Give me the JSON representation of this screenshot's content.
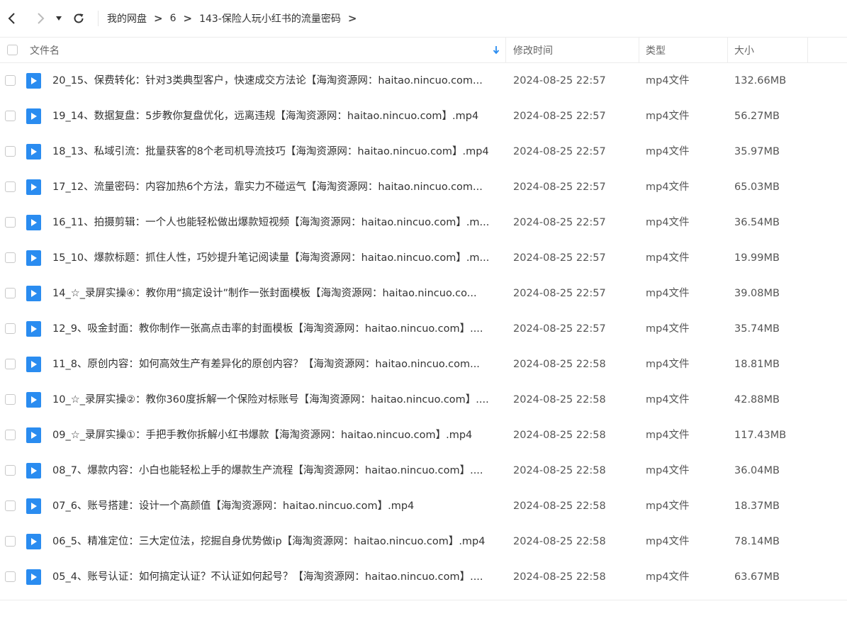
{
  "toolbar": {
    "breadcrumb": [
      "我的网盘",
      "6",
      "143-保险人玩小红书的流量密码"
    ]
  },
  "columns": {
    "name": "文件名",
    "modified": "修改时间",
    "type": "类型",
    "size": "大小"
  },
  "colors": {
    "file_icon": "#2a8cf0",
    "sort_arrow": "#2a8cf0"
  },
  "files": [
    {
      "name": "20_15、保费转化：针对3类典型客户，快速成交方法论【海淘资源网：haitao.nincuo.com...",
      "modified": "2024-08-25 22:57",
      "type": "mp4文件",
      "size": "132.66MB"
    },
    {
      "name": "19_14、数据复盘：5步教你复盘优化，远离违规【海淘资源网：haitao.nincuo.com】.mp4",
      "modified": "2024-08-25 22:57",
      "type": "mp4文件",
      "size": "56.27MB"
    },
    {
      "name": "18_13、私域引流：批量获客的8个老司机导流技巧【海淘资源网：haitao.nincuo.com】.mp4",
      "modified": "2024-08-25 22:57",
      "type": "mp4文件",
      "size": "35.97MB"
    },
    {
      "name": "17_12、流量密码：内容加热6个方法，靠实力不碰运气【海淘资源网：haitao.nincuo.com...",
      "modified": "2024-08-25 22:57",
      "type": "mp4文件",
      "size": "65.03MB"
    },
    {
      "name": "16_11、拍摄剪辑：一个人也能轻松做出爆款短视频【海淘资源网：haitao.nincuo.com】.m...",
      "modified": "2024-08-25 22:57",
      "type": "mp4文件",
      "size": "36.54MB"
    },
    {
      "name": "15_10、爆款标题：抓住人性，巧妙提升笔记阅读量【海淘资源网：haitao.nincuo.com】.m...",
      "modified": "2024-08-25 22:57",
      "type": "mp4文件",
      "size": "19.99MB"
    },
    {
      "name": "14_☆_录屏实操④：教你用“搞定设计”制作一张封面模板【海淘资源网：haitao.nincuo.co...",
      "modified": "2024-08-25 22:57",
      "type": "mp4文件",
      "size": "39.08MB"
    },
    {
      "name": "12_9、吸金封面：教你制作一张高点击率的封面模板【海淘资源网：haitao.nincuo.com】....",
      "modified": "2024-08-25 22:57",
      "type": "mp4文件",
      "size": "35.74MB"
    },
    {
      "name": "11_8、原创内容：如何高效生产有差异化的原创内容？【海淘资源网：haitao.nincuo.com...",
      "modified": "2024-08-25 22:58",
      "type": "mp4文件",
      "size": "18.81MB"
    },
    {
      "name": "10_☆_录屏实操②：教你360度拆解一个保险对标账号【海淘资源网：haitao.nincuo.com】....",
      "modified": "2024-08-25 22:58",
      "type": "mp4文件",
      "size": "42.88MB"
    },
    {
      "name": "09_☆_录屏实操①：手把手教你拆解小红书爆款【海淘资源网：haitao.nincuo.com】.mp4",
      "modified": "2024-08-25 22:58",
      "type": "mp4文件",
      "size": "117.43MB"
    },
    {
      "name": "08_7、爆款内容：小白也能轻松上手的爆款生产流程【海淘资源网：haitao.nincuo.com】....",
      "modified": "2024-08-25 22:58",
      "type": "mp4文件",
      "size": "36.04MB"
    },
    {
      "name": "07_6、账号搭建：设计一个高颜值【海淘资源网：haitao.nincuo.com】.mp4",
      "modified": "2024-08-25 22:58",
      "type": "mp4文件",
      "size": "18.37MB"
    },
    {
      "name": "06_5、精准定位：三大定位法，挖掘自身优势做ip【海淘资源网：haitao.nincuo.com】.mp4",
      "modified": "2024-08-25 22:58",
      "type": "mp4文件",
      "size": "78.14MB"
    },
    {
      "name": "05_4、账号认证：如何搞定认证？不认证如何起号？【海淘资源网：haitao.nincuo.com】....",
      "modified": "2024-08-25 22:58",
      "type": "mp4文件",
      "size": "63.67MB"
    }
  ]
}
